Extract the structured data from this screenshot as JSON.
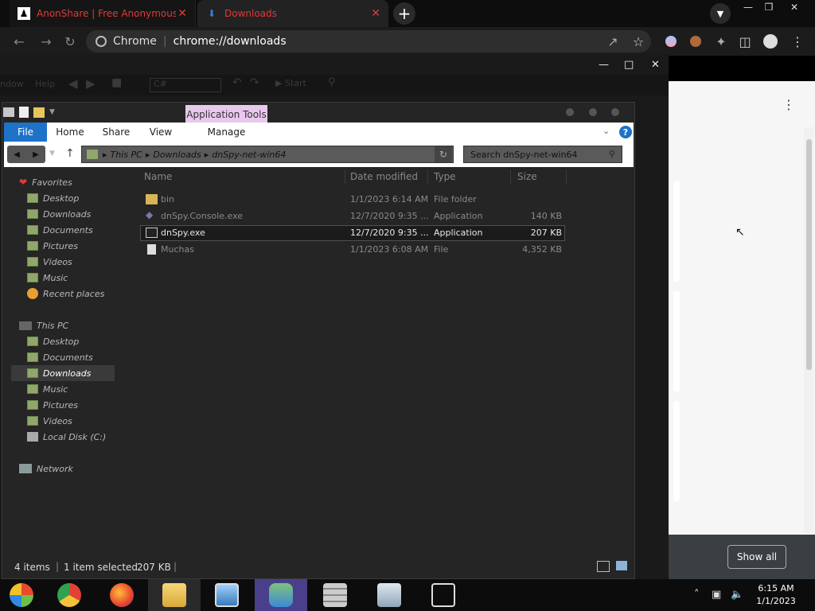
{
  "chrome": {
    "tabs": [
      {
        "title": "AnonShare | Free Anonymous File",
        "favicon": "anon-figure-icon"
      },
      {
        "title": "Downloads",
        "favicon": "download-icon"
      }
    ],
    "omnibox": {
      "site": "Chrome",
      "url": "chrome://downloads"
    },
    "downloads_bar": {
      "show_all_label": "Show all"
    },
    "accent": "#e23838"
  },
  "explorer": {
    "context_tab": "Application Tools",
    "ribbon_tabs": [
      "File",
      "Home",
      "Share",
      "View",
      "Manage"
    ],
    "address": [
      "This PC",
      "Downloads",
      "dnSpy-net-win64"
    ],
    "search_placeholder": "Search dnSpy-net-win64",
    "columns": [
      "Name",
      "Date modified",
      "Type",
      "Size"
    ],
    "files": [
      {
        "name": "bin",
        "date": "1/1/2023 6:14 AM",
        "type": "File folder",
        "size": "",
        "icon": "folder-icon"
      },
      {
        "name": "dnSpy.Console.exe",
        "date": "12/7/2020 9:35 ...",
        "type": "Application",
        "size": "140 KB",
        "icon": "exe-icon"
      },
      {
        "name": "dnSpy.exe",
        "date": "12/7/2020 9:35 ...",
        "type": "Application",
        "size": "207 KB",
        "icon": "app-icon",
        "selected": true
      },
      {
        "name": "Muchas",
        "date": "1/1/2023 6:08 AM",
        "type": "File",
        "size": "4,352 KB",
        "icon": "file-icon"
      }
    ],
    "nav": {
      "favorites_label": "Favorites",
      "favorites": [
        "Desktop",
        "Downloads",
        "Documents",
        "Pictures",
        "Videos",
        "Music",
        "Recent places"
      ],
      "thispc_label": "This PC",
      "thispc": [
        "Desktop",
        "Documents",
        "Downloads",
        "Music",
        "Pictures",
        "Videos",
        "Local Disk (C:)"
      ],
      "network_label": "Network"
    },
    "status": {
      "count": "4 items",
      "selection": "1 item selected",
      "size": "207 KB"
    }
  },
  "dnspy": {
    "menu": [
      "ndow",
      "Help"
    ],
    "lang": "C#",
    "start": "Start"
  },
  "taskbar": {
    "time": "6:15 AM",
    "date": "1/1/2023"
  }
}
